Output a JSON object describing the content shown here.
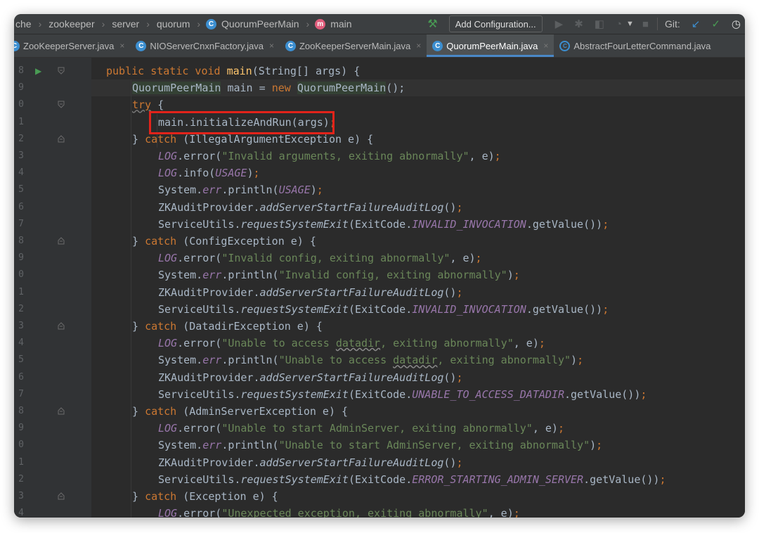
{
  "navbar": {
    "breadcrumbs": [
      {
        "label": "che",
        "icon": ""
      },
      {
        "label": "zookeeper",
        "icon": ""
      },
      {
        "label": "server",
        "icon": ""
      },
      {
        "label": "quorum",
        "icon": ""
      },
      {
        "label": "QuorumPeerMain",
        "icon": "class-icon"
      },
      {
        "label": "main",
        "icon": "method-icon"
      }
    ],
    "add_configuration": "Add Configuration...",
    "git_label": "Git:"
  },
  "tabs": [
    {
      "label": "ZooKeeperServer.java",
      "active": false,
      "icon": "class-icon"
    },
    {
      "label": "NIOServerCnxnFactory.java",
      "active": false,
      "icon": "class-icon"
    },
    {
      "label": "ZooKeeperServerMain.java",
      "active": false,
      "icon": "class-icon"
    },
    {
      "label": "QuorumPeerMain.java",
      "active": true,
      "icon": "class-icon"
    },
    {
      "label": "AbstractFourLetterCommand.java",
      "active": false,
      "icon": "abstract-class-icon"
    }
  ],
  "gutter": {
    "line_numbers": [
      "8",
      "9",
      "0",
      "1",
      "2",
      "3",
      "4",
      "5",
      "6",
      "7",
      "8",
      "9",
      "0",
      "1",
      "2",
      "3",
      "4",
      "5",
      "6",
      "7",
      "8",
      "9",
      "0",
      "1",
      "2",
      "3",
      "4"
    ]
  },
  "code_lines": [
    {
      "indent": 0,
      "tokens": [
        {
          "t": "public static void ",
          "c": "kw"
        },
        {
          "t": "main",
          "c": "fn"
        },
        {
          "t": "(String[] args) {",
          "c": "txt"
        }
      ]
    },
    {
      "indent": 1,
      "tokens": [
        {
          "t": "QuorumPeerMain",
          "c": "txt hlvar"
        },
        {
          "t": " main = ",
          "c": "txt"
        },
        {
          "t": "new ",
          "c": "kw"
        },
        {
          "t": "QuorumPeerMain",
          "c": "txt hlvar"
        },
        {
          "t": "();",
          "c": "txt"
        }
      ]
    },
    {
      "indent": 1,
      "tokens": [
        {
          "t": "try",
          "c": "kw"
        },
        {
          "t": " {",
          "c": "txt"
        }
      ]
    },
    {
      "indent": 2,
      "tokens": [
        {
          "t": "main.initializeAndRun(args)",
          "c": "txt"
        },
        {
          "t": ";",
          "c": "kw"
        }
      ]
    },
    {
      "indent": 1,
      "tokens": [
        {
          "t": "} ",
          "c": "txt"
        },
        {
          "t": "catch ",
          "c": "kw"
        },
        {
          "t": "(IllegalArgumentException e) {",
          "c": "txt"
        }
      ]
    },
    {
      "indent": 2,
      "tokens": [
        {
          "t": "LOG",
          "c": "cst"
        },
        {
          "t": ".error(",
          "c": "txt"
        },
        {
          "t": "\"Invalid arguments, exiting abnormally\"",
          "c": "str"
        },
        {
          "t": ", e)",
          "c": "txt"
        },
        {
          "t": ";",
          "c": "kw"
        }
      ]
    },
    {
      "indent": 2,
      "tokens": [
        {
          "t": "LOG",
          "c": "cst"
        },
        {
          "t": ".info(",
          "c": "txt"
        },
        {
          "t": "USAGE",
          "c": "cst"
        },
        {
          "t": ")",
          "c": "txt"
        },
        {
          "t": ";",
          "c": "kw"
        }
      ]
    },
    {
      "indent": 2,
      "tokens": [
        {
          "t": "System.",
          "c": "txt"
        },
        {
          "t": "err",
          "c": "cst"
        },
        {
          "t": ".println(",
          "c": "txt"
        },
        {
          "t": "USAGE",
          "c": "cst"
        },
        {
          "t": ")",
          "c": "txt"
        },
        {
          "t": ";",
          "c": "kw"
        }
      ]
    },
    {
      "indent": 2,
      "tokens": [
        {
          "t": "ZKAuditProvider.",
          "c": "txt"
        },
        {
          "t": "addServerStartFailureAuditLog",
          "c": "txt ital"
        },
        {
          "t": "()",
          "c": "txt"
        },
        {
          "t": ";",
          "c": "kw"
        }
      ]
    },
    {
      "indent": 2,
      "tokens": [
        {
          "t": "ServiceUtils.",
          "c": "txt"
        },
        {
          "t": "requestSystemExit",
          "c": "txt ital"
        },
        {
          "t": "(ExitCode.",
          "c": "txt"
        },
        {
          "t": "INVALID_INVOCATION",
          "c": "cst"
        },
        {
          "t": ".getValue())",
          "c": "txt"
        },
        {
          "t": ";",
          "c": "kw"
        }
      ]
    },
    {
      "indent": 1,
      "tokens": [
        {
          "t": "} ",
          "c": "txt"
        },
        {
          "t": "catch ",
          "c": "kw"
        },
        {
          "t": "(ConfigException e) {",
          "c": "txt"
        }
      ]
    },
    {
      "indent": 2,
      "tokens": [
        {
          "t": "LOG",
          "c": "cst"
        },
        {
          "t": ".error(",
          "c": "txt"
        },
        {
          "t": "\"Invalid config, exiting abnormally\"",
          "c": "str"
        },
        {
          "t": ", e)",
          "c": "txt"
        },
        {
          "t": ";",
          "c": "kw"
        }
      ]
    },
    {
      "indent": 2,
      "tokens": [
        {
          "t": "System.",
          "c": "txt"
        },
        {
          "t": "err",
          "c": "cst"
        },
        {
          "t": ".println(",
          "c": "txt"
        },
        {
          "t": "\"Invalid config, exiting abnormally\"",
          "c": "str"
        },
        {
          "t": ")",
          "c": "txt"
        },
        {
          "t": ";",
          "c": "kw"
        }
      ]
    },
    {
      "indent": 2,
      "tokens": [
        {
          "t": "ZKAuditProvider.",
          "c": "txt"
        },
        {
          "t": "addServerStartFailureAuditLog",
          "c": "txt ital"
        },
        {
          "t": "()",
          "c": "txt"
        },
        {
          "t": ";",
          "c": "kw"
        }
      ]
    },
    {
      "indent": 2,
      "tokens": [
        {
          "t": "ServiceUtils.",
          "c": "txt"
        },
        {
          "t": "requestSystemExit",
          "c": "txt ital"
        },
        {
          "t": "(ExitCode.",
          "c": "txt"
        },
        {
          "t": "INVALID_INVOCATION",
          "c": "cst"
        },
        {
          "t": ".getValue())",
          "c": "txt"
        },
        {
          "t": ";",
          "c": "kw"
        }
      ]
    },
    {
      "indent": 1,
      "tokens": [
        {
          "t": "} ",
          "c": "txt"
        },
        {
          "t": "catch ",
          "c": "kw"
        },
        {
          "t": "(DatadirException e) {",
          "c": "txt"
        }
      ]
    },
    {
      "indent": 2,
      "tokens": [
        {
          "t": "LOG",
          "c": "cst"
        },
        {
          "t": ".error(",
          "c": "txt"
        },
        {
          "t": "\"Unable to access datadir, exiting abnormally\"",
          "c": "str"
        },
        {
          "t": ", e)",
          "c": "txt"
        },
        {
          "t": ";",
          "c": "kw"
        }
      ]
    },
    {
      "indent": 2,
      "tokens": [
        {
          "t": "System.",
          "c": "txt"
        },
        {
          "t": "err",
          "c": "cst"
        },
        {
          "t": ".println(",
          "c": "txt"
        },
        {
          "t": "\"Unable to access datadir, exiting abnormally\"",
          "c": "str"
        },
        {
          "t": ")",
          "c": "txt"
        },
        {
          "t": ";",
          "c": "kw"
        }
      ]
    },
    {
      "indent": 2,
      "tokens": [
        {
          "t": "ZKAuditProvider.",
          "c": "txt"
        },
        {
          "t": "addServerStartFailureAuditLog",
          "c": "txt ital"
        },
        {
          "t": "()",
          "c": "txt"
        },
        {
          "t": ";",
          "c": "kw"
        }
      ]
    },
    {
      "indent": 2,
      "tokens": [
        {
          "t": "ServiceUtils.",
          "c": "txt"
        },
        {
          "t": "requestSystemExit",
          "c": "txt ital"
        },
        {
          "t": "(ExitCode.",
          "c": "txt"
        },
        {
          "t": "UNABLE_TO_ACCESS_DATADIR",
          "c": "cst"
        },
        {
          "t": ".getValue())",
          "c": "txt"
        },
        {
          "t": ";",
          "c": "kw"
        }
      ]
    },
    {
      "indent": 1,
      "tokens": [
        {
          "t": "} ",
          "c": "txt"
        },
        {
          "t": "catch ",
          "c": "kw"
        },
        {
          "t": "(AdminServerException e) {",
          "c": "txt"
        }
      ]
    },
    {
      "indent": 2,
      "tokens": [
        {
          "t": "LOG",
          "c": "cst"
        },
        {
          "t": ".error(",
          "c": "txt"
        },
        {
          "t": "\"Unable to start AdminServer, exiting abnormally\"",
          "c": "str"
        },
        {
          "t": ", e)",
          "c": "txt"
        },
        {
          "t": ";",
          "c": "kw"
        }
      ]
    },
    {
      "indent": 2,
      "tokens": [
        {
          "t": "System.",
          "c": "txt"
        },
        {
          "t": "err",
          "c": "cst"
        },
        {
          "t": ".println(",
          "c": "txt"
        },
        {
          "t": "\"Unable to start AdminServer, exiting abnormally\"",
          "c": "str"
        },
        {
          "t": ")",
          "c": "txt"
        },
        {
          "t": ";",
          "c": "kw"
        }
      ]
    },
    {
      "indent": 2,
      "tokens": [
        {
          "t": "ZKAuditProvider.",
          "c": "txt"
        },
        {
          "t": "addServerStartFailureAuditLog",
          "c": "txt ital"
        },
        {
          "t": "()",
          "c": "txt"
        },
        {
          "t": ";",
          "c": "kw"
        }
      ]
    },
    {
      "indent": 2,
      "tokens": [
        {
          "t": "ServiceUtils.",
          "c": "txt"
        },
        {
          "t": "requestSystemExit",
          "c": "txt ital"
        },
        {
          "t": "(ExitCode.",
          "c": "txt"
        },
        {
          "t": "ERROR_STARTING_ADMIN_SERVER",
          "c": "cst"
        },
        {
          "t": ".getValue())",
          "c": "txt"
        },
        {
          "t": ";",
          "c": "kw"
        }
      ]
    },
    {
      "indent": 1,
      "tokens": [
        {
          "t": "} ",
          "c": "txt"
        },
        {
          "t": "catch ",
          "c": "kw"
        },
        {
          "t": "(Exception e) {",
          "c": "txt"
        }
      ]
    },
    {
      "indent": 2,
      "tokens": [
        {
          "t": "LOG",
          "c": "cst"
        },
        {
          "t": ".error(",
          "c": "txt"
        },
        {
          "t": "\"Unexpected exception, exiting abnormally\"",
          "c": "str"
        },
        {
          "t": ", e)",
          "c": "txt"
        },
        {
          "t": ";",
          "c": "kw"
        }
      ]
    }
  ],
  "colors": {
    "highlight_box": "#e2231a",
    "keyword": "#cc7832",
    "string": "#6a8759",
    "constant": "#9876aa",
    "method_name": "#ffc66d"
  }
}
